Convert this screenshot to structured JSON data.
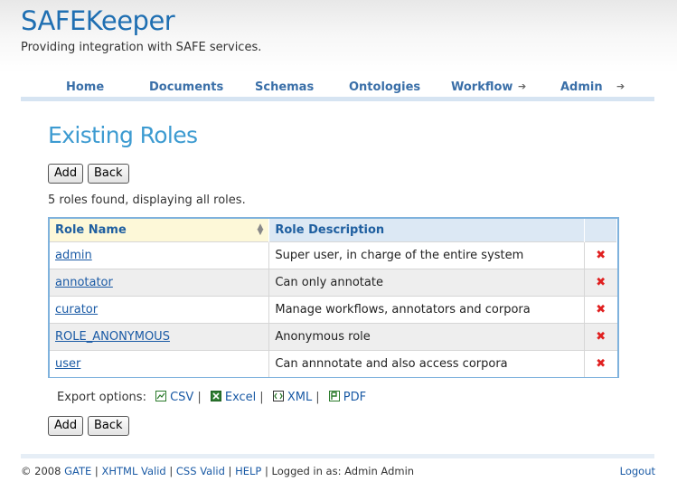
{
  "header": {
    "title": "SAFEKeeper",
    "tagline": "Providing integration with SAFE services."
  },
  "nav": {
    "items": [
      {
        "label": "Home"
      },
      {
        "label": "Documents"
      },
      {
        "label": "Schemas"
      },
      {
        "label": "Ontologies"
      },
      {
        "label": "Workflow",
        "submenu": true
      },
      {
        "label": "Admin",
        "submenu": true
      }
    ]
  },
  "main": {
    "title": "Existing Roles",
    "add_label": "Add",
    "back_label": "Back",
    "found_text": "5 roles found, displaying all roles.",
    "columns": [
      "Role Name",
      "Role Description"
    ],
    "rows": [
      {
        "name": "admin",
        "description": "Super user, in charge of the entire system"
      },
      {
        "name": "annotator",
        "description": "Can only annotate"
      },
      {
        "name": "curator",
        "description": "Manage workflows, annotators and corpora"
      },
      {
        "name": "ROLE_ANONYMOUS",
        "description": "Anonymous role"
      },
      {
        "name": "user",
        "description": "Can annnotate and also access corpora"
      }
    ],
    "export": {
      "label": "Export options:",
      "options": [
        "CSV",
        "Excel",
        "XML",
        "PDF"
      ]
    }
  },
  "footer": {
    "copyright": "© 2008",
    "links": [
      "GATE",
      "XHTML Valid",
      "CSS Valid",
      "HELP"
    ],
    "logged_in": "Logged in as: Admin Admin",
    "logout": "Logout"
  },
  "colors": {
    "brand_blue": "#1f6fb2",
    "title_blue": "#3d9bd1",
    "link_blue": "#1a5aa5",
    "delete_red": "#e02020"
  }
}
